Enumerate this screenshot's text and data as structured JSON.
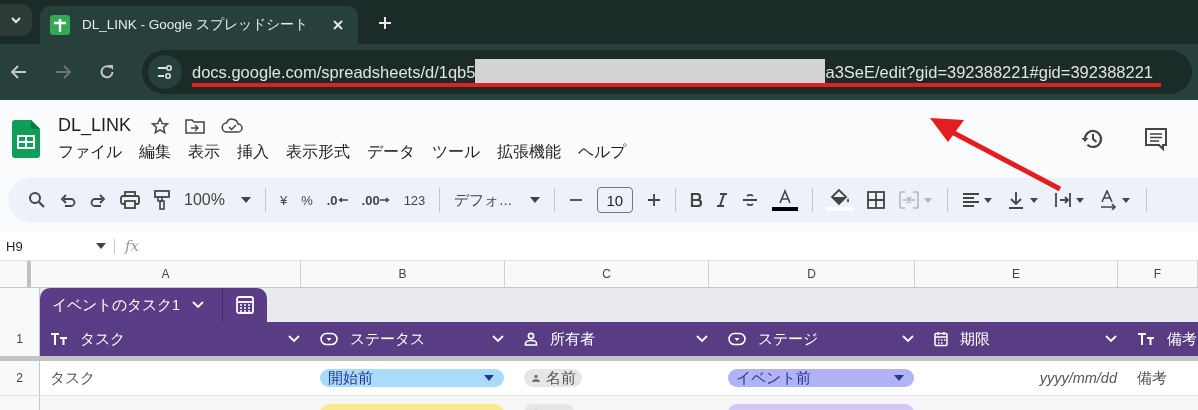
{
  "browser": {
    "tab_title": "DL_LINK - Google スプレッドシート",
    "url_start": "docs.google.com/spreadsheets/d/1qb5",
    "url_redacted": true,
    "url_end": "a3SeE/edit?gid=392388221#gid=392388221",
    "url_underlined": true
  },
  "doc": {
    "title": "DL_LINK",
    "menu": [
      "ファイル",
      "編集",
      "表示",
      "挿入",
      "表示形式",
      "データ",
      "ツール",
      "拡張機能",
      "ヘルプ"
    ]
  },
  "toolbar": {
    "zoom": "100%",
    "currency": "¥",
    "percent": "%",
    "decrease_decimal": ".0",
    "increase_decimal": ".00",
    "number_format": "123",
    "font": "デフォ...",
    "font_size": "10"
  },
  "formula_bar": {
    "cell_ref": "H9",
    "fx": "fx"
  },
  "columns": [
    "A",
    "B",
    "C",
    "D",
    "E",
    "F"
  ],
  "table": {
    "name": "イベントのタスク1",
    "header_row_number": "1",
    "headers": [
      {
        "kind": "text",
        "label": "タスク"
      },
      {
        "kind": "dropdown",
        "label": "ステータス"
      },
      {
        "kind": "person",
        "label": "所有者"
      },
      {
        "kind": "dropdown",
        "label": "ステージ"
      },
      {
        "kind": "date",
        "label": "期限"
      },
      {
        "kind": "text",
        "label": "備考"
      }
    ],
    "rows": [
      {
        "number": "2",
        "cells": [
          {
            "kind": "text",
            "text": "タスク"
          },
          {
            "kind": "chip",
            "text": "開始前",
            "color": "#a8dcfa"
          },
          {
            "kind": "person",
            "text": "名前"
          },
          {
            "kind": "chip",
            "text": "イベント前",
            "color": "#b1b3f4"
          },
          {
            "kind": "date",
            "text": "yyyy/mm/dd"
          },
          {
            "kind": "text",
            "text": "備考"
          }
        ]
      },
      {
        "cells": [
          {
            "kind": "empty"
          },
          {
            "kind": "chip",
            "color": "#fbe98e"
          },
          {
            "kind": "person"
          },
          {
            "kind": "chip",
            "color": "#d4c6f7"
          },
          {
            "kind": "empty"
          },
          {
            "kind": "empty"
          }
        ]
      }
    ]
  },
  "annotation_arrow": true
}
